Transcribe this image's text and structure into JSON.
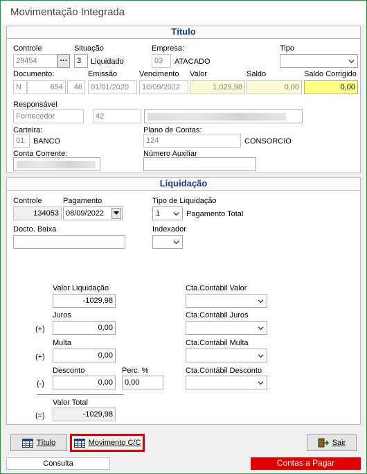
{
  "window": {
    "title": "Movimentação Integrada"
  },
  "titulo": {
    "header": "Título",
    "controle_label": "Controle",
    "controle_value": "29454",
    "controle_btn": "···",
    "situacao_label": "Situação",
    "situacao_code": "3",
    "situacao_text": "Liquidado",
    "empresa_label": "Empresa:",
    "empresa_code": "03",
    "empresa_text": "ATACADO",
    "tipo_label": "Tipo",
    "tipo_value": "",
    "documento_label": "Documento:",
    "doc_tipo": "N",
    "doc_numero": "654",
    "doc_parcela": "46",
    "emissao_label": "Emissão",
    "emissao_value": "01/01/2020",
    "vencimento_label": "Vencimento",
    "vencimento_value": "10/09/2022",
    "valor_label": "Valor",
    "valor_value": "1.029,98",
    "saldo_label": "Saldo",
    "saldo_value": "0,00",
    "saldo_corrigido_label": "Saldo Corrigido",
    "saldo_corrigido_value": "0,00",
    "responsavel_label": "Responsável",
    "responsavel_tipo": "Fornecedor",
    "responsavel_code": "42",
    "carteira_label": "Carteira:",
    "carteira_code": "01",
    "carteira_text": "BANCO",
    "plano_label": "Plano de Contas:",
    "plano_code": "124",
    "plano_text": "CONSORCIO",
    "conta_corrente_label": "Conta Corrente:",
    "numero_auxiliar_label": "Número Auxiliar",
    "numero_auxiliar_value": ""
  },
  "liquidacao": {
    "header": "Liquidação",
    "controle_label": "Controle",
    "controle_value": "134053",
    "pagamento_label": "Pagamento",
    "pagamento_value": "08/09/2022",
    "tipo_liq_label": "Tipo de Liquidação",
    "tipo_liq_code": "1",
    "tipo_liq_text": "Pagamento Total",
    "docto_baixa_label": "Docto. Baixa",
    "docto_baixa_value": "",
    "indexador_label": "Indexador",
    "valor_liq_label": "Valor Liquidação",
    "valor_liq_value": "-1029,98",
    "juros_label": "Juros",
    "juros_sign": "(+)",
    "juros_value": "0,00",
    "multa_label": "Multa",
    "multa_sign": "(+)",
    "multa_value": "0,00",
    "desconto_label": "Desconto",
    "desconto_sign": "(-)",
    "desconto_value": "0,00",
    "perc_label": "Perc. %",
    "perc_value": "0,00",
    "valor_total_label": "Valor Total",
    "valor_total_sign": "(=)",
    "valor_total_value": "-1029,98",
    "cta_valor_label": "Cta.Contábil Valor",
    "cta_juros_label": "Cta.Contábil Juros",
    "cta_multa_label": "Cta.Contábil Multa",
    "cta_desconto_label": "Cta.Contábil Desconto"
  },
  "buttons": {
    "titulo": "Título",
    "movimento": "Movimento C/C",
    "sair": "Sair"
  },
  "status": {
    "left": "Consulta",
    "right": "Contas a Pagar"
  },
  "colors": {
    "highlight_border": "#e00000",
    "header_text": "#1a3a8c",
    "status_right_bg": "#e00000"
  }
}
